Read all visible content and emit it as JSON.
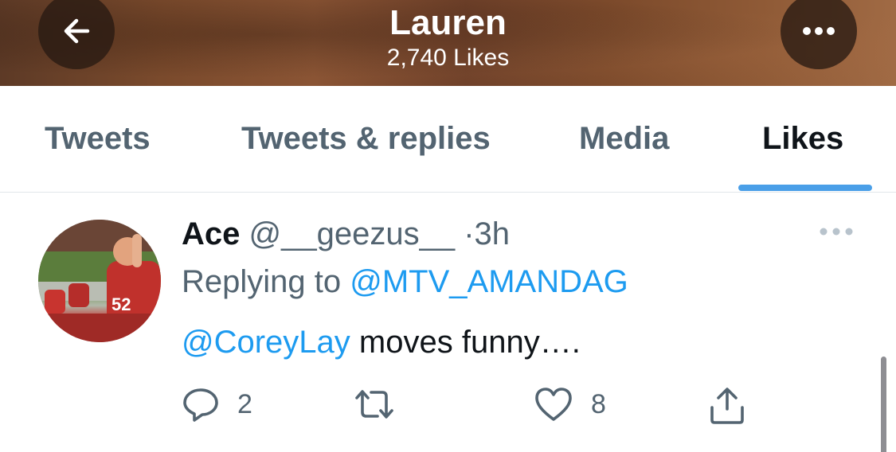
{
  "header": {
    "title": "Lauren",
    "subtitle": "2,740 Likes",
    "back_icon": "arrow-left-icon",
    "more_icon": "more-horizontal-icon"
  },
  "tabs": [
    {
      "label": "Tweets",
      "active": false
    },
    {
      "label": "Tweets & replies",
      "active": false
    },
    {
      "label": "Media",
      "active": false
    },
    {
      "label": "Likes",
      "active": true
    }
  ],
  "tweet": {
    "author_name": "Ace",
    "author_handle": "@__geezus__",
    "separator": "·",
    "time": "3h",
    "replying_prefix": "Replying to",
    "replying_to": "@MTV_AMANDAG",
    "mention": "@CoreyLay",
    "text": "moves funny….",
    "actions": {
      "reply_count": "2",
      "retweet_count": "",
      "like_count": "8"
    }
  },
  "colors": {
    "accent": "#1d9bf0",
    "tab_indicator": "#4a9fe8",
    "secondary_text": "#536471",
    "primary_text": "#0f1419"
  }
}
